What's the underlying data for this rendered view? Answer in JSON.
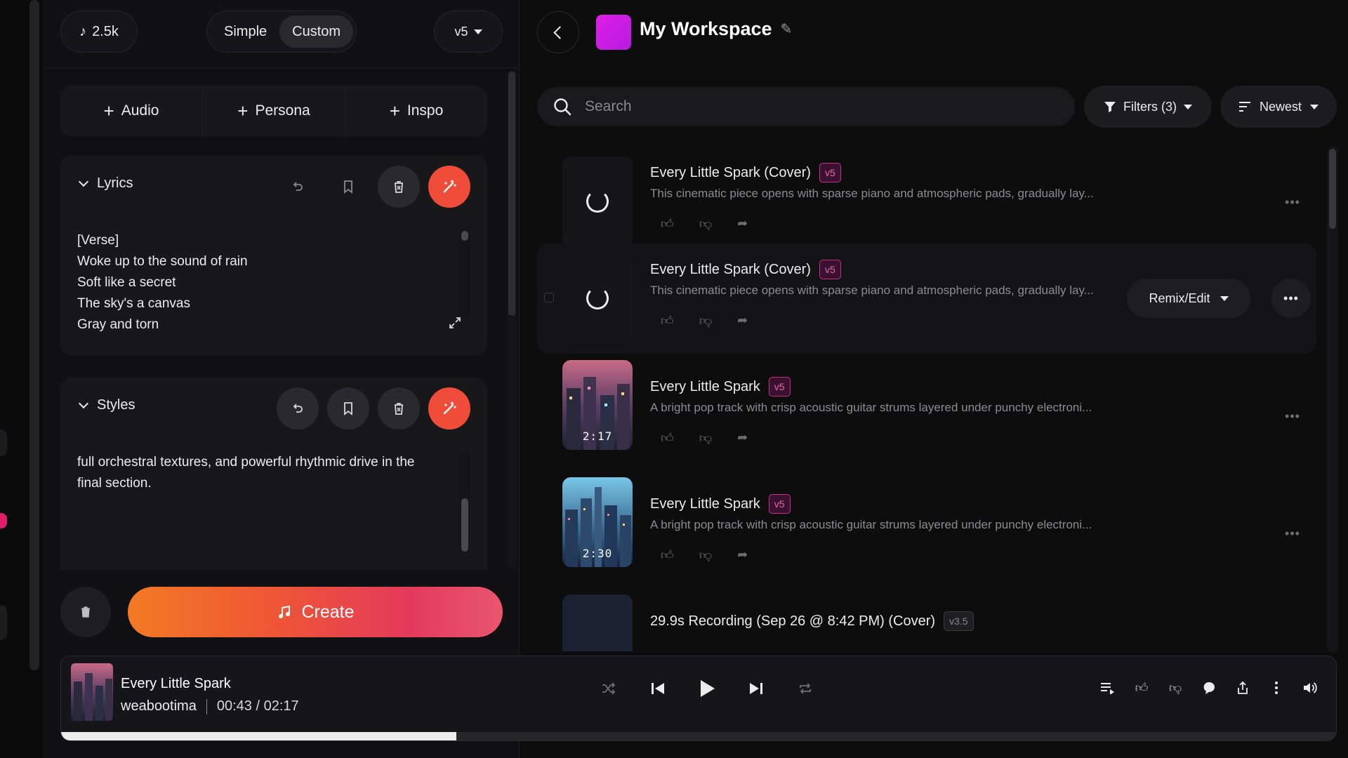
{
  "left_panel": {
    "credits": "2.5k",
    "mode_simple": "Simple",
    "mode_custom": "Custom",
    "version": "v5",
    "add_audio": "Audio",
    "add_persona": "Persona",
    "add_inspo": "Inspo",
    "lyrics": {
      "label": "Lyrics",
      "text": "[Verse]\nWoke up to the sound of rain\nSoft like a secret\nThe sky's a canvas\nGray and torn"
    },
    "styles": {
      "label": "Styles",
      "text": "full orchestral textures, and powerful rhythmic drive in the final section."
    },
    "create_label": "Create"
  },
  "workspace": {
    "title": "My Workspace",
    "search_placeholder": "Search",
    "filters_label": "Filters (3)",
    "sort_label": "Newest",
    "remix_label": "Remix/Edit"
  },
  "songs": [
    {
      "title": "Every Little Spark (Cover)",
      "badge": "v5",
      "desc": "This cinematic piece opens with sparse piano and atmospheric pads, gradually lay...",
      "duration": ""
    },
    {
      "title": "Every Little Spark (Cover)",
      "badge": "v5",
      "desc": "This cinematic piece opens with sparse piano and atmospheric pads, gradually lay...",
      "duration": ""
    },
    {
      "title": "Every Little Spark",
      "badge": "v5",
      "desc": "A bright pop track with crisp acoustic guitar strums layered under punchy electroni...",
      "duration": "2:17"
    },
    {
      "title": "Every Little Spark",
      "badge": "v5",
      "desc": "A bright pop track with crisp acoustic guitar strums layered under punchy electroni...",
      "duration": "2:30"
    },
    {
      "title": "29.9s Recording (Sep 26 @ 8:42 PM) (Cover)",
      "badge": "v3.5",
      "desc": "",
      "duration": ""
    }
  ],
  "player": {
    "title": "Every Little Spark",
    "artist": "weabootima",
    "current_time": "00:43",
    "total_time": "02:17",
    "progress_fraction": 0.31
  },
  "colors": {
    "accent": "#ef4c3a",
    "badge": "#c22e88",
    "workspace_avatar": "#d41ee6"
  }
}
